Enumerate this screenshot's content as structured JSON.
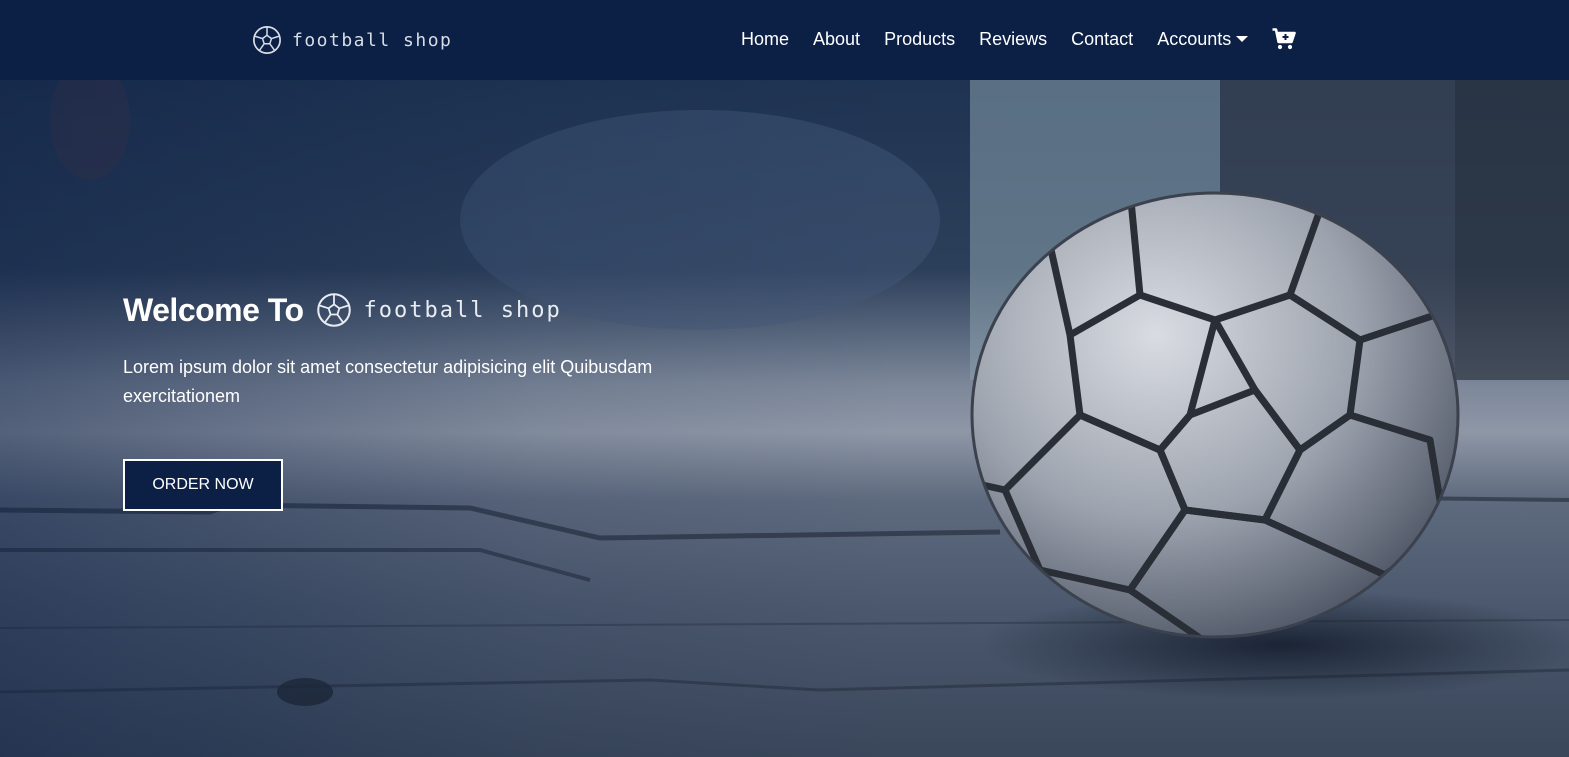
{
  "brand": {
    "name": "football shop",
    "icon": "soccer-ball-icon"
  },
  "nav": {
    "items": [
      {
        "label": "Home"
      },
      {
        "label": "About"
      },
      {
        "label": "Products"
      },
      {
        "label": "Reviews"
      },
      {
        "label": "Contact"
      },
      {
        "label": "Accounts"
      }
    ],
    "accounts_icon": "caret-down-icon",
    "cart_icon": "cart-icon"
  },
  "hero": {
    "title": "Welcome To",
    "brand_name": "football shop",
    "description": "Lorem ipsum dolor sit amet consectetur adipisicing elit Quibusdam exercitationem",
    "cta_label": "ORDER NOW"
  },
  "colors": {
    "navbar_bg": "#0c1f45",
    "accent": "#0c1f45",
    "text": "#ffffff"
  }
}
